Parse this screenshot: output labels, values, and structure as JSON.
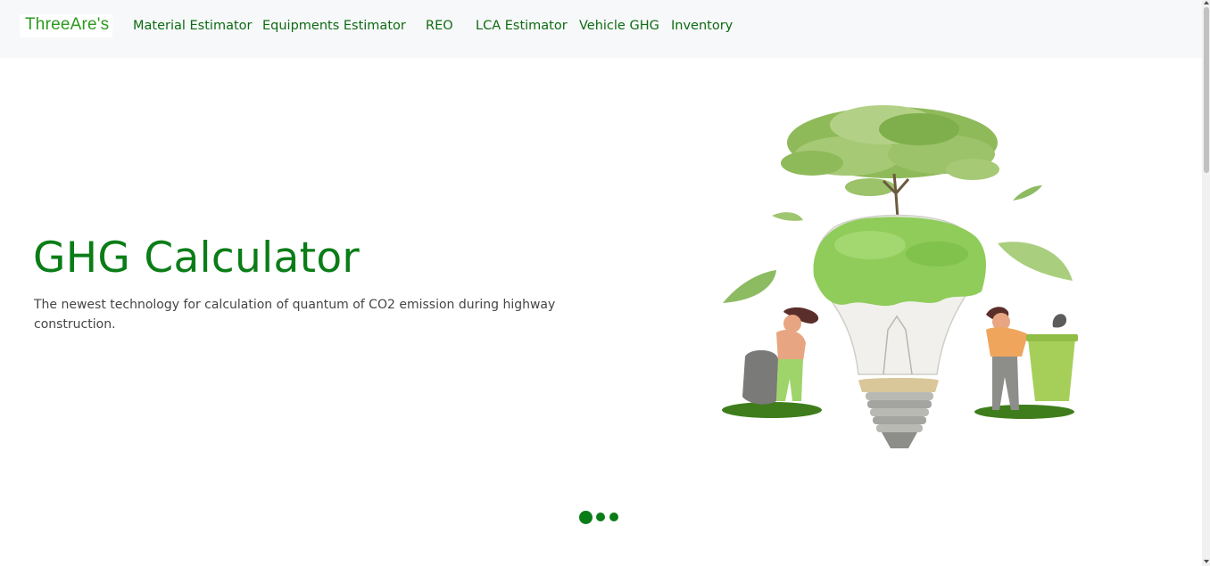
{
  "navbar": {
    "brand": "ThreeAre's",
    "links": [
      {
        "label": "Material Estimator"
      },
      {
        "label": "Equipments Estimator"
      },
      {
        "label": "REO"
      },
      {
        "label": "LCA Estimator"
      },
      {
        "label": "Vehicle GHG"
      },
      {
        "label": "Inventory"
      }
    ]
  },
  "hero": {
    "title": "GHG Calculator",
    "subtitle": "The newest technology for calculation of quantum of CO2 emission during highway construction.",
    "illustration_icon": "lightbulb-tree-recycling-illustration"
  },
  "carousel": {
    "slide_count": 3,
    "active_index": 0
  },
  "colors": {
    "accent_green": "#0a7d17",
    "nav_link": "#0e6b14",
    "navbar_bg": "#f7f8f9",
    "subtitle_text": "#454545"
  }
}
